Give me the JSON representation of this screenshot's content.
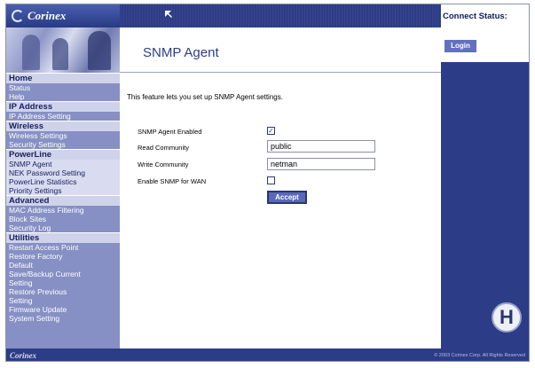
{
  "brand": {
    "logo": "Corinex",
    "footer_logo": "Corinex",
    "copyright": "© 2003 Corinex Corp. All Rights Reserved"
  },
  "sidebar": {
    "items": [
      {
        "label": "Home",
        "kind": "hdr"
      },
      {
        "label": "Status",
        "kind": "item"
      },
      {
        "label": "Help",
        "kind": "item"
      },
      {
        "label": "IP Address",
        "kind": "hdr"
      },
      {
        "label": "IP Address Setting",
        "kind": "item"
      },
      {
        "label": "Wireless",
        "kind": "hdr"
      },
      {
        "label": "Wireless Settings",
        "kind": "item"
      },
      {
        "label": "Security Settings",
        "kind": "item"
      },
      {
        "label": "PowerLine",
        "kind": "hdr"
      },
      {
        "label": "SNMP Agent",
        "kind": "sel"
      },
      {
        "label": "NEK Password Setting",
        "kind": "sel"
      },
      {
        "label": "PowerLine Statistics",
        "kind": "sel"
      },
      {
        "label": "Priority Settings",
        "kind": "sel"
      },
      {
        "label": "Advanced",
        "kind": "hdr"
      },
      {
        "label": "MAC Address Filtering",
        "kind": "item"
      },
      {
        "label": "Block Sites",
        "kind": "item"
      },
      {
        "label": "Security Log",
        "kind": "item"
      },
      {
        "label": "Utilities",
        "kind": "hdr"
      },
      {
        "label": "Restart Access Point",
        "kind": "item"
      },
      {
        "label": "Restore Factory",
        "kind": "item"
      },
      {
        "label": "Default",
        "kind": "item"
      },
      {
        "label": "Save/Backup Current",
        "kind": "item"
      },
      {
        "label": "Setting",
        "kind": "item"
      },
      {
        "label": "Restore Previous",
        "kind": "item"
      },
      {
        "label": "Setting",
        "kind": "item"
      },
      {
        "label": "Firmware Update",
        "kind": "item"
      },
      {
        "label": "System Setting",
        "kind": "item"
      }
    ]
  },
  "main": {
    "title": "SNMP Agent",
    "intro": "This feature lets you set up SNMP Agent settings.",
    "form": {
      "snmp_enabled_label": "SNMP Agent Enabled",
      "snmp_enabled_checked": true,
      "read_community_label": "Read Community",
      "read_community_value": "public",
      "write_community_label": "Write Community",
      "write_community_value": "netman",
      "snmp_wan_label": "Enable SNMP for WAN",
      "snmp_wan_checked": false,
      "accept_label": "Accept"
    }
  },
  "right_panel": {
    "connect_label": "Connect Status:",
    "login_label": "Login",
    "help_letter": "H"
  },
  "colors": {
    "accent": "#2c3c86",
    "sidebar": "#8690c4",
    "button": "#5a68b8"
  },
  "icons": [
    "logo-icon",
    "cursor-icon",
    "help-icon",
    "checkbox-checked-icon"
  ]
}
